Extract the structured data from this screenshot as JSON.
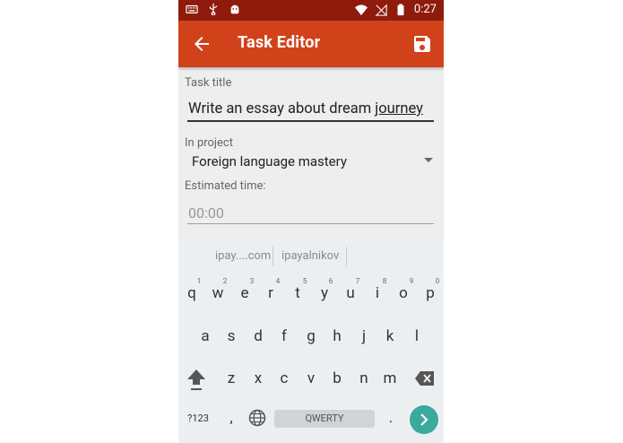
{
  "status_bar": {
    "time": "0:27"
  },
  "toolbar": {
    "title": "Task Editor"
  },
  "form": {
    "title_label": "Task title",
    "title_value_start": "Write an essay about dream ",
    "title_value_underlined": "journey",
    "project_label": "In project",
    "project_value": "Foreign language mastery",
    "time_label": "Estimated time:",
    "time_placeholder": "00:00"
  },
  "keyboard": {
    "suggestions": [
      "ipay....com",
      "ipayalnikov"
    ],
    "row1": [
      "q",
      "w",
      "e",
      "r",
      "t",
      "y",
      "u",
      "i",
      "o",
      "p"
    ],
    "row1_hints": [
      "1",
      "2",
      "3",
      "4",
      "5",
      "6",
      "7",
      "8",
      "9",
      "0"
    ],
    "row2": [
      "a",
      "s",
      "d",
      "f",
      "g",
      "h",
      "j",
      "k",
      "l"
    ],
    "row3": [
      "z",
      "x",
      "c",
      "v",
      "b",
      "n",
      "m"
    ],
    "symbols_label": "?123",
    "comma": ",",
    "space_label": "QWERTY",
    "period": "."
  },
  "colors": {
    "status_bar": "#8e1b0c",
    "toolbar": "#d2421a",
    "enter_key": "#3ba99c"
  }
}
